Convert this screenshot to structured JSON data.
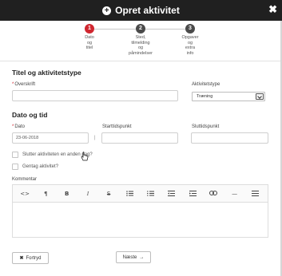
{
  "header": {
    "title": "Opret aktivitet",
    "plus_glyph": "+",
    "close_glyph": "✖"
  },
  "stepper": {
    "steps": [
      {
        "number": "1",
        "label": "Dato\nog\ntitel",
        "state": "active"
      },
      {
        "number": "2",
        "label": "Sted,\ntilmelding\nog\npåmindelser",
        "state": "inactive"
      },
      {
        "number": "3",
        "label": "Opgaver\nog\nextra\ninfo",
        "state": "inactive"
      }
    ]
  },
  "title_section": {
    "heading": "Titel og aktivitetstype",
    "overskrift_label": "Overskrift",
    "overskrift_value": "",
    "type_label": "Aktivitetstype",
    "type_selected": "Træning"
  },
  "date_section": {
    "heading": "Dato og tid",
    "dato_label": "Dato",
    "dato_value": "23-06-2018",
    "starttid_label": "Starttidspunkt",
    "starttid_value": "",
    "sluttid_label": "Sluttidspunkt",
    "sluttid_value": "",
    "separator": "|",
    "required_marker": "*"
  },
  "options": {
    "other_day_label": "Slutter aktiviteten en anden dag?",
    "repeat_label": "Gentag aktivitet?"
  },
  "comment": {
    "label": "Kommentar",
    "toolbar": [
      {
        "name": "code-view",
        "glyph": "<>"
      },
      {
        "name": "paragraph",
        "glyph": "¶"
      },
      {
        "name": "bold",
        "glyph": "B"
      },
      {
        "name": "italic",
        "glyph": "I"
      },
      {
        "name": "strikethrough",
        "glyph": "S"
      },
      {
        "name": "bullet-list",
        "glyph": ""
      },
      {
        "name": "numbered-list",
        "glyph": ""
      },
      {
        "name": "outdent",
        "glyph": ""
      },
      {
        "name": "indent",
        "glyph": ""
      },
      {
        "name": "link",
        "glyph": ""
      },
      {
        "name": "horizontal-rule",
        "glyph": "—"
      },
      {
        "name": "align",
        "glyph": ""
      }
    ]
  },
  "footer": {
    "cancel_label": "Fortryd",
    "cancel_glyph": "✖",
    "next_label": "Næste",
    "next_glyph": "→"
  },
  "colors": {
    "titlebar": "#202020",
    "step_active": "#d0262f",
    "step_inactive": "#4a4a4a",
    "required": "#d0262f"
  }
}
